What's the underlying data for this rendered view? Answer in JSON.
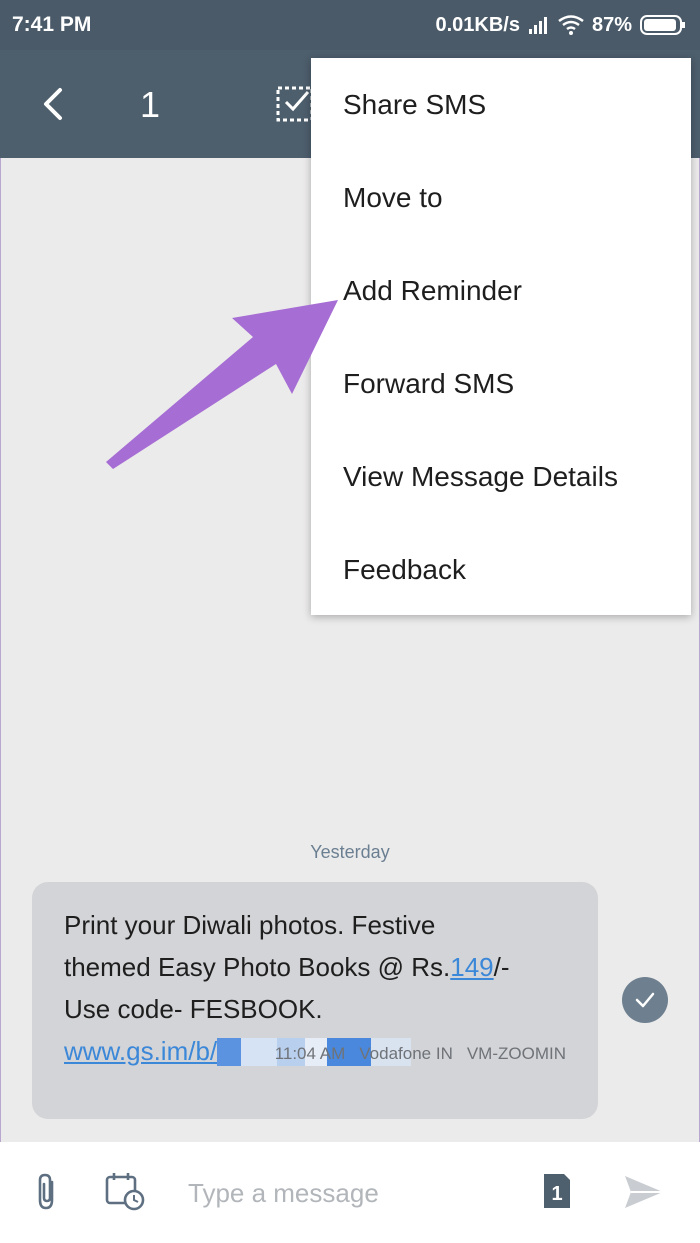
{
  "status_bar": {
    "time": "7:41 PM",
    "network_speed": "0.01KB/s",
    "battery": "87%"
  },
  "app_bar": {
    "selected_count": "1"
  },
  "context_menu": {
    "items": [
      {
        "label": "Share SMS"
      },
      {
        "label": "Move to"
      },
      {
        "label": "Add Reminder"
      },
      {
        "label": "Forward SMS"
      },
      {
        "label": "View Message Details"
      },
      {
        "label": "Feedback"
      }
    ]
  },
  "conversation": {
    "date_separator": "Yesterday",
    "message": {
      "line1": "Print your Diwali photos. Festive",
      "line2_prefix": "themed Easy Photo Books @ Rs.",
      "line2_link": "149",
      "line2_suffix": "/-",
      "line3": "Use code- FESBOOK.",
      "link_text": "www.gs.im/b/",
      "time": "11:04 AM",
      "carrier": "Vodafone IN",
      "sender": "VM-ZOOMIN"
    }
  },
  "composer": {
    "placeholder": "Type a message",
    "sim_label": "1"
  },
  "colors": {
    "app_bar": "#4d5e6c",
    "annotation_arrow": "#a66dd4",
    "link": "#3b87d8"
  }
}
